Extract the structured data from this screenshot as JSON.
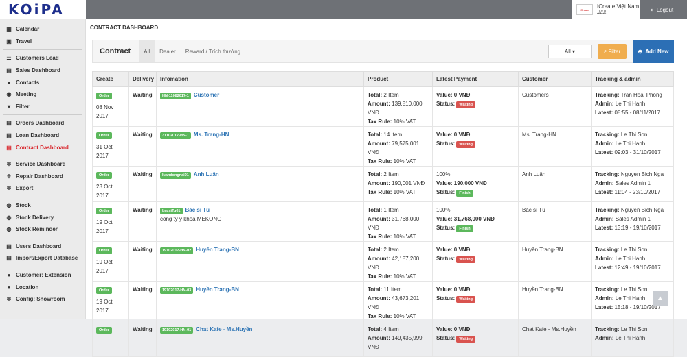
{
  "logo": "KOiPA",
  "user": {
    "name": "ICreate Việt Nam",
    "sub": "###",
    "avatar": "iCreate",
    "logout": "Logout"
  },
  "sidebar": {
    "items": [
      {
        "label": "Calendar",
        "icon": "calendar-icon",
        "glyph": "▦",
        "group": 1
      },
      {
        "label": "Travel",
        "icon": "travel-icon",
        "glyph": "▣",
        "group": 1
      },
      {
        "label": "Customers Lead",
        "icon": "list-icon",
        "glyph": "☰",
        "group": 2
      },
      {
        "label": "Sales Dashboard",
        "icon": "table-icon",
        "glyph": "▤",
        "group": 2
      },
      {
        "label": "Contacts",
        "icon": "user-icon",
        "glyph": "●",
        "group": 2
      },
      {
        "label": "Meeting",
        "icon": "comment-icon",
        "glyph": "◉",
        "group": 2
      },
      {
        "label": "Filter",
        "icon": "filter-icon",
        "glyph": "▾",
        "group": 2
      },
      {
        "label": "Orders Dashboard",
        "icon": "table-icon",
        "glyph": "▤",
        "group": 3
      },
      {
        "label": "Loan Dashboard",
        "icon": "table-icon",
        "glyph": "▤",
        "group": 3
      },
      {
        "label": "Contract Dashboard",
        "icon": "table-icon",
        "glyph": "▤",
        "group": 3,
        "active": true
      },
      {
        "label": "Service Dashboard",
        "icon": "gears-icon",
        "glyph": "✲",
        "group": 4
      },
      {
        "label": "Repair Dashboard",
        "icon": "gears-icon",
        "glyph": "✲",
        "group": 4
      },
      {
        "label": "Export",
        "icon": "gear-icon",
        "glyph": "✲",
        "group": 4
      },
      {
        "label": "Stock",
        "icon": "database-icon",
        "glyph": "◍",
        "group": 5
      },
      {
        "label": "Stock Delivery",
        "icon": "database-icon",
        "glyph": "◍",
        "group": 5
      },
      {
        "label": "Stock Reminder",
        "icon": "database-icon",
        "glyph": "◍",
        "group": 5
      },
      {
        "label": "Users Dashboard",
        "icon": "users-icon",
        "glyph": "▤",
        "group": 6
      },
      {
        "label": "Import/Export Database",
        "icon": "users-icon",
        "glyph": "▤",
        "group": 6
      },
      {
        "label": "Customer: Extension",
        "icon": "map-marker-icon",
        "glyph": "●",
        "group": 7
      },
      {
        "label": "Location",
        "icon": "map-marker-icon",
        "glyph": "●",
        "group": 7
      },
      {
        "label": "Config: Showroom",
        "icon": "gear-icon",
        "glyph": "✲",
        "group": 7
      }
    ]
  },
  "page": {
    "title": "CONTRACT DASHBOARD",
    "contract_label": "Contract",
    "tabs": [
      "All",
      "Dealer",
      "Reward / Trích thưởng"
    ],
    "filter_select": "All ▾",
    "filter_button": "Filter",
    "add_button": "Add New"
  },
  "table": {
    "headers": [
      "Create",
      "Delivery",
      "Infomation",
      "Product",
      "Latest Payment",
      "Customer",
      "Tracking & admin"
    ],
    "rows": [
      {
        "badge": "Order",
        "date": "08 Nov 2017",
        "delivery": "Waiting",
        "code": "HN-11082017-1",
        "name": "Customer",
        "extra": "",
        "total": "2 Item",
        "amount": "139,810,000 VNĐ",
        "tax": "10% VAT",
        "pay1": "Value: 0 VNĐ",
        "pay2": "",
        "status": "Waiting",
        "customer": "Customers",
        "tracking": "Tran Hoai Phong",
        "admin": "Le Thi Hanh",
        "latest": "08:55 - 08/11/2017"
      },
      {
        "badge": "Order",
        "date": "31 Oct 2017",
        "delivery": "Waiting",
        "code": "31102017-HN-1",
        "name": "Ms. Trang-HN",
        "extra": "",
        "total": "14 Item",
        "amount": "79,575,001 VNĐ",
        "tax": "10% VAT",
        "pay1": "Value: 0 VNĐ",
        "pay2": "",
        "status": "Waiting",
        "customer": "Ms. Trang-HN",
        "tracking": "Le Thi Son",
        "admin": "Le Thi Hanh",
        "latest": "09:03 - 31/10/2017"
      },
      {
        "badge": "Order",
        "date": "23 Oct 2017",
        "delivery": "Waiting",
        "code": "luandongnai01",
        "name": "Anh Luân",
        "extra": "",
        "total": "2 Item",
        "amount": "190,001 VNĐ",
        "tax": "10% VAT",
        "pay1": "100%",
        "pay2": "Value: 190,000 VNĐ",
        "status": "Finish",
        "customer": "Anh Luân",
        "tracking": "Nguyen Bich Nga",
        "admin": "Sales Admin 1",
        "latest": "11:04 - 23/10/2017"
      },
      {
        "badge": "Order",
        "date": "19 Oct 2017",
        "delivery": "Waiting",
        "code": "bacsiTu01",
        "name": "Bác sĩ Tú",
        "extra": "công ty y khoa MEKONG",
        "total": "1 Item",
        "amount": "31,768,000 VNĐ",
        "tax": "10% VAT",
        "pay1": "100%",
        "pay2": "Value: 31,768,000 VNĐ",
        "status": "Finish",
        "customer": "Bác sĩ Tú",
        "tracking": "Nguyen Bich Nga",
        "admin": "Sales Admin 1",
        "latest": "13:19 - 19/10/2017"
      },
      {
        "badge": "Order",
        "date": "19 Oct 2017",
        "delivery": "Waiting",
        "code": "19102017-HN-02",
        "name": "Huyền Trang-BN",
        "extra": "",
        "total": "2 Item",
        "amount": "42,187,200 VNĐ",
        "tax": "10% VAT",
        "pay1": "Value: 0 VNĐ",
        "pay2": "",
        "status": "Waiting",
        "customer": "Huyền Trang-BN",
        "tracking": "Le Thi Son",
        "admin": "Le Thi Hanh",
        "latest": "12:49 - 19/10/2017"
      },
      {
        "badge": "Order",
        "date": "19 Oct 2017",
        "delivery": "Waiting",
        "code": "19102017-HN-03",
        "name": "Huyền Trang-BN",
        "extra": "",
        "total": "11 Item",
        "amount": "43,673,201 VNĐ",
        "tax": "10% VAT",
        "pay1": "Value: 0 VNĐ",
        "pay2": "",
        "status": "Waiting",
        "customer": "Huyền Trang-BN",
        "tracking": "Le Thi Son",
        "admin": "Le Thi Hanh",
        "latest": "15:18 - 19/10/2017"
      },
      {
        "badge": "Order",
        "date": "",
        "delivery": "Waiting",
        "code": "19102017-HN-01",
        "name": "Chat Kafe - Ms.Huyền",
        "extra": "",
        "total": "4 Item",
        "amount": "149,435,999 VNĐ",
        "tax": "",
        "pay1": "Value: 0 VNĐ",
        "pay2": "",
        "status": "Waiting",
        "customer": "Chat Kafe - Ms.Huyền",
        "tracking": "Le Thi Son",
        "admin": "Le Thi Hanh",
        "latest": ""
      }
    ]
  },
  "labels": {
    "total": "Total:",
    "amount": "Amount:",
    "tax": "Tax Rule:",
    "status": "Status:",
    "tracking": "Tracking:",
    "admin": "Admin:",
    "latest": "Latest:"
  }
}
